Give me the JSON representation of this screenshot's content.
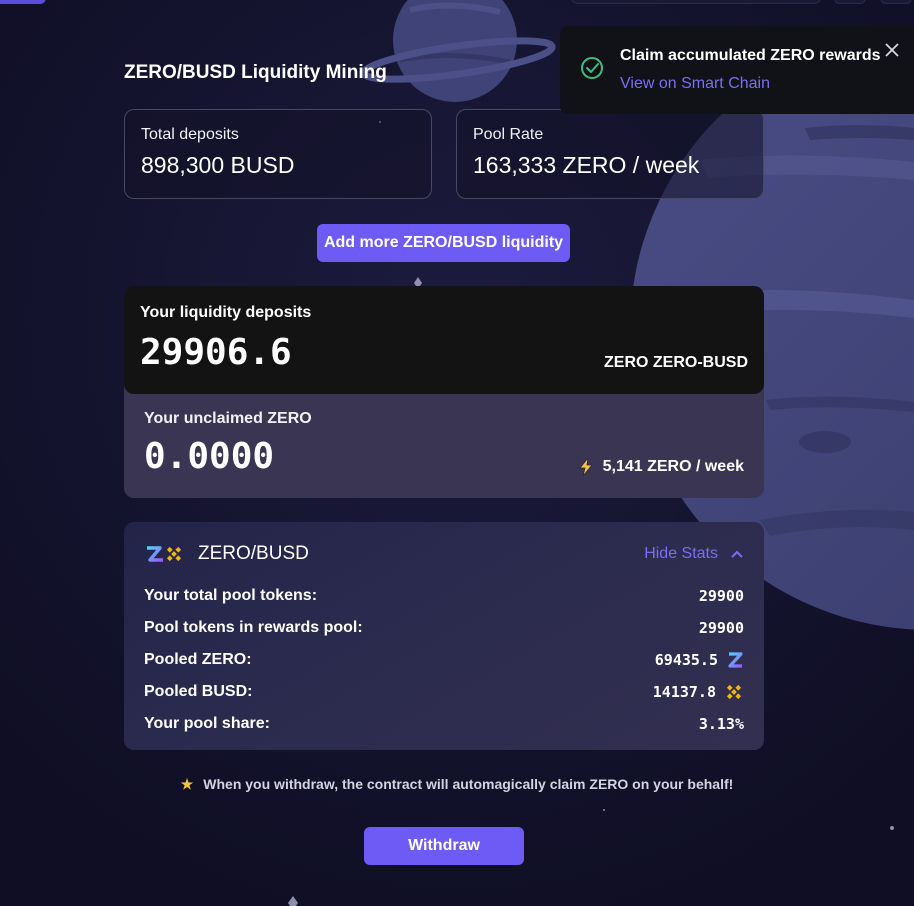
{
  "page": {
    "title": "ZERO/BUSD Liquidity Mining"
  },
  "stats": {
    "total_deposits_label": "Total deposits",
    "total_deposits_value": "898,300 BUSD",
    "pool_rate_label": "Pool Rate",
    "pool_rate_value": "163,333 ZERO / week"
  },
  "add_liquidity_label": "Add more ZERO/BUSD liquidity",
  "deposits": {
    "label": "Your liquidity deposits",
    "value": "29906.6",
    "unit": "ZERO ZERO-BUSD"
  },
  "unclaimed": {
    "label": "Your unclaimed ZERO",
    "value": "0.0000",
    "rate": "5,141 ZERO / week",
    "rate_icon": "lightning-icon"
  },
  "pool": {
    "name": "ZERO/BUSD",
    "hide_stats_label": "Hide Stats",
    "rows": [
      {
        "label": "Your total pool tokens:",
        "value": "29900",
        "icon": ""
      },
      {
        "label": "Pool tokens in rewards pool:",
        "value": "29900",
        "icon": ""
      },
      {
        "label": "Pooled ZERO:",
        "value": "69435.5",
        "icon": "zero-token-icon"
      },
      {
        "label": "Pooled BUSD:",
        "value": "14137.8",
        "icon": "busd-token-icon"
      },
      {
        "label": "Your pool share:",
        "value": "3.13%",
        "icon": ""
      }
    ]
  },
  "note": "When you withdraw, the contract will automagically claim ZERO on your behalf!",
  "withdraw_label": "Withdraw",
  "toast": {
    "title": "Claim accumulated ZERO rewards",
    "link": "View on Smart Chain"
  },
  "colors": {
    "background": "#13122b",
    "accent": "#6e5bf5",
    "link": "#7d6cf5",
    "success": "#3fbf7f",
    "busd_yellow": "#f0b90b"
  }
}
